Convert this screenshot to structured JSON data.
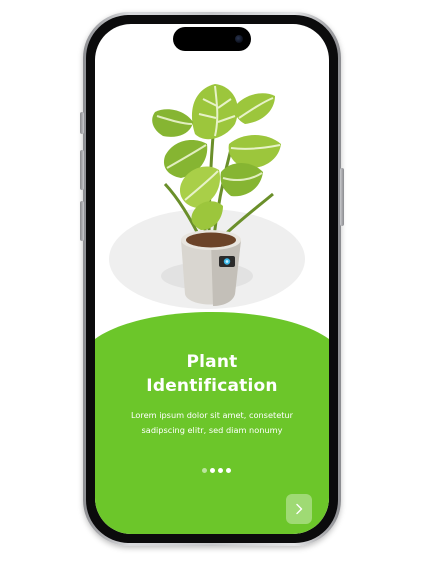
{
  "colors": {
    "accent_green": "#6cc62a",
    "phone_frame": "#c8c9cc",
    "bezel": "#0b0b0c"
  },
  "onboarding": {
    "title_line_1": "Plant",
    "title_line_2": "Identification",
    "description_line_1": "Lorem ipsum dolor sit amet, consetetur",
    "description_line_2": "sadipscing elitr, sed diam nonumy",
    "page_indicator": {
      "total_pages": 4,
      "current_page": 1
    },
    "next_icon": "chevron-right-icon"
  }
}
